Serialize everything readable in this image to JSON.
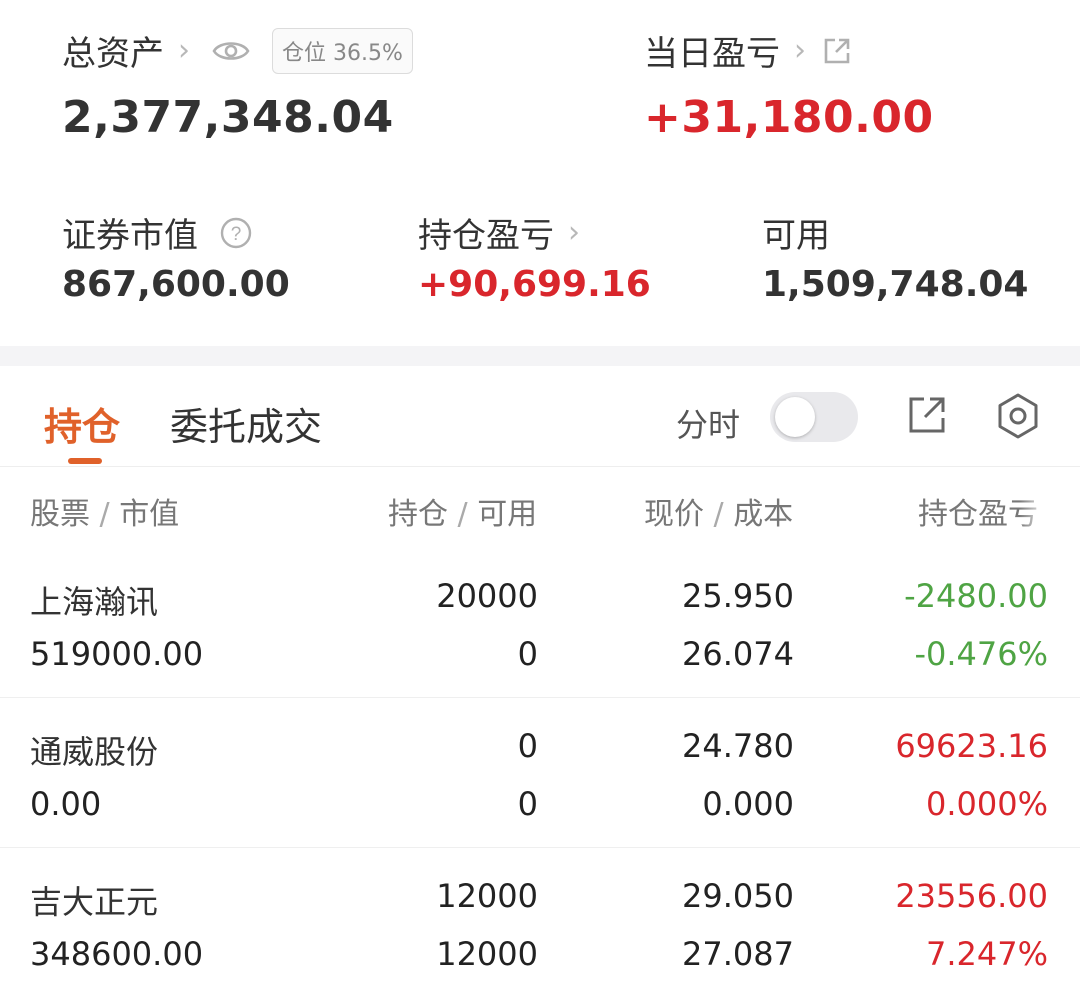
{
  "summary": {
    "total_assets_label": "总资产",
    "total_assets_value": "2,377,348.04",
    "position_badge": "仓位 36.5%",
    "daily_pnl_label": "当日盈亏",
    "daily_pnl_value": "+31,180.00",
    "market_value_label": "证券市值",
    "market_value": "867,600.00",
    "holding_pnl_label": "持仓盈亏",
    "holding_pnl_value": "+90,699.16",
    "available_label": "可用",
    "available_value": "1,509,748.04"
  },
  "tabs": {
    "holdings": "持仓",
    "orders": "委托成交",
    "fenshi_label": "分时"
  },
  "table": {
    "headers": {
      "stock_a": "股票",
      "stock_b": "市值",
      "qty_a": "持仓",
      "qty_b": "可用",
      "price_a": "现价",
      "price_b": "成本",
      "pnl": "持仓盈亏"
    },
    "rows": [
      {
        "name": "上海瀚讯",
        "market_value": "519000.00",
        "holding": "20000",
        "available": "0",
        "price": "25.950",
        "cost": "26.074",
        "pnl": "-2480.00",
        "pnl_pct": "-0.476%",
        "trend": "down"
      },
      {
        "name": "通威股份",
        "market_value": "0.00",
        "holding": "0",
        "available": "0",
        "price": "24.780",
        "cost": "0.000",
        "pnl": "69623.16",
        "pnl_pct": "0.000%",
        "trend": "up"
      },
      {
        "name": "吉大正元",
        "market_value": "348600.00",
        "holding": "12000",
        "available": "12000",
        "price": "29.050",
        "cost": "27.087",
        "pnl": "23556.00",
        "pnl_pct": "7.247%",
        "trend": "up"
      }
    ]
  },
  "colors": {
    "accent": "#e0612a",
    "up": "#d9262c",
    "down": "#4fa444"
  }
}
